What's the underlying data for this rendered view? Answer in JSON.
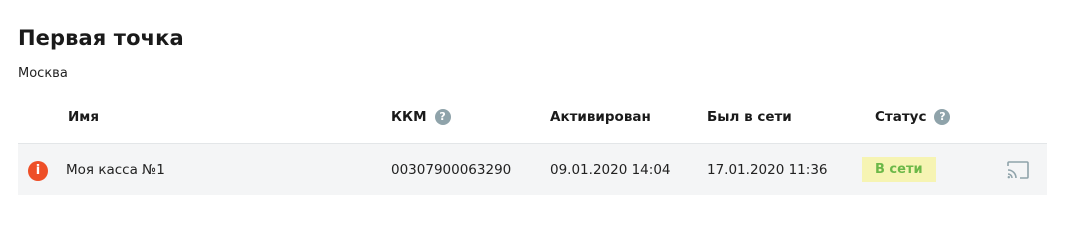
{
  "point": {
    "title": "Первая точка",
    "city": "Москва"
  },
  "table": {
    "headers": {
      "name": "Имя",
      "kkm": "ККМ",
      "activated": "Активирован",
      "last_online": "Был в сети",
      "status": "Статус"
    },
    "help_glyph": "?",
    "rows": [
      {
        "alert_icon": "info-alert-icon",
        "alert_glyph": "i",
        "name": "Моя касса №1",
        "kkm": "00307900063290",
        "activated": "09.01.2020 14:04",
        "last_online": "17.01.2020 11:36",
        "status": "В сети",
        "action_icon": "cast-icon"
      }
    ]
  },
  "colors": {
    "alert": "#ee4f27",
    "help_icon": "#8fa3aa",
    "status_bg": "#f6f4b3",
    "status_text": "#6cb848",
    "row_bg": "#f4f5f6",
    "cast_icon": "#8fa3aa"
  }
}
